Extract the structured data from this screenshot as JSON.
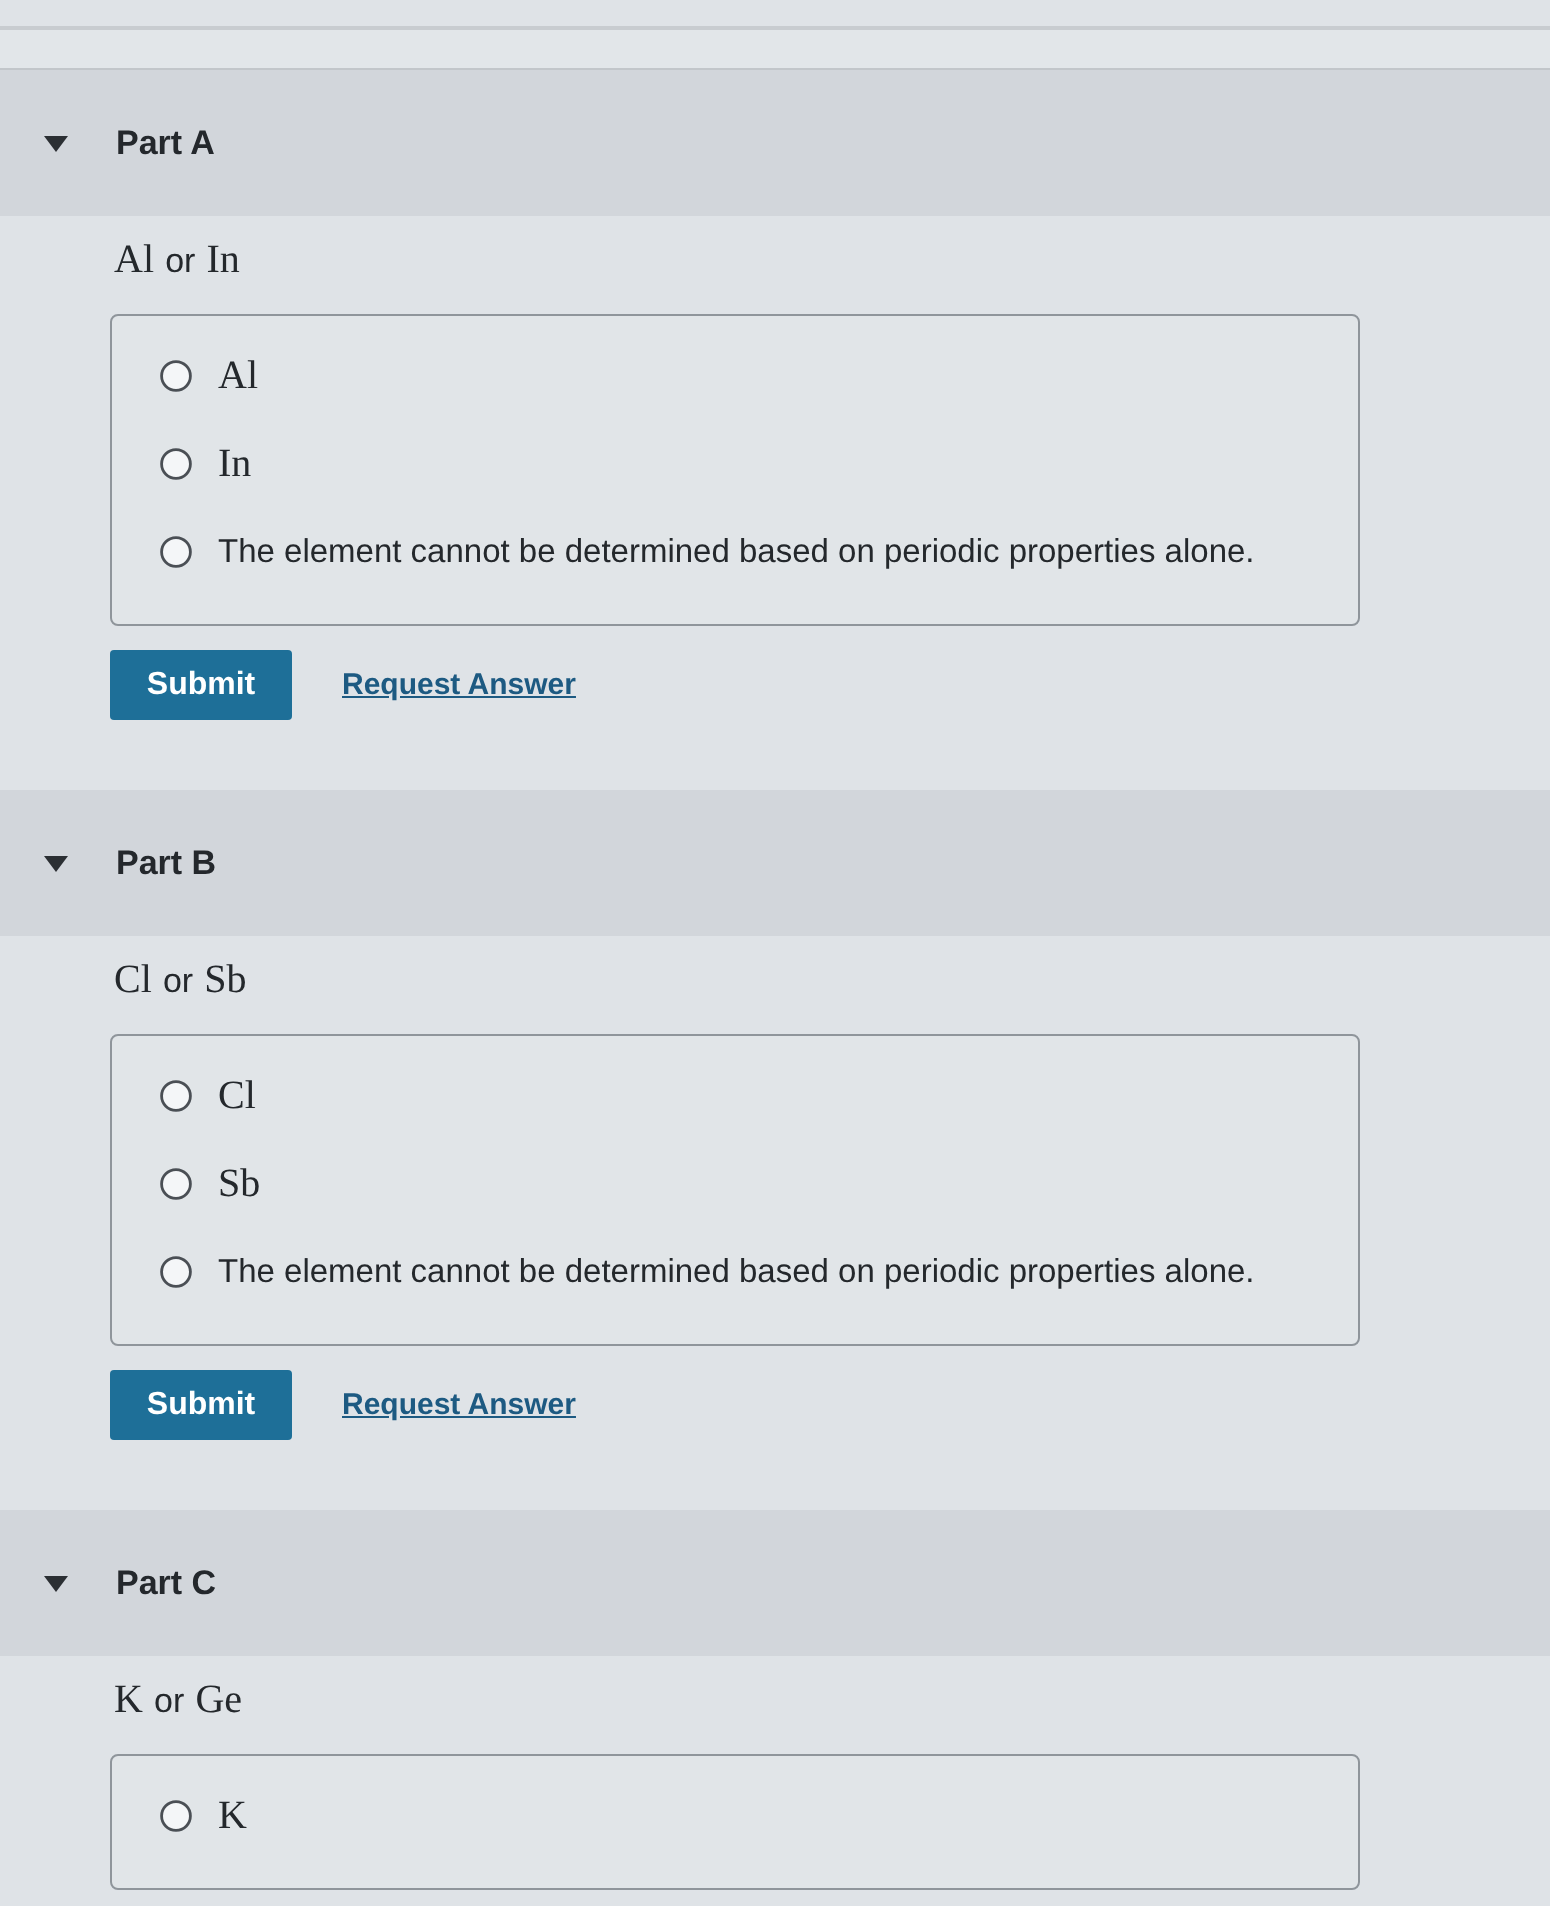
{
  "parts": [
    {
      "title": "Part A",
      "expanded": true,
      "prompt": [
        {
          "kind": "symbol",
          "text": "Al"
        },
        {
          "kind": "word",
          "text": "or"
        },
        {
          "kind": "symbol",
          "text": "In"
        }
      ],
      "options": [
        {
          "kind": "symbol",
          "text": "Al",
          "selected": false
        },
        {
          "kind": "symbol",
          "text": "In",
          "selected": false
        },
        {
          "kind": "sentence",
          "text": "The element cannot be determined based on periodic properties alone.",
          "selected": false
        }
      ],
      "submit": "Submit",
      "request_answer": "Request Answer"
    },
    {
      "title": "Part B",
      "expanded": true,
      "prompt": [
        {
          "kind": "symbol",
          "text": "Cl"
        },
        {
          "kind": "word",
          "text": "or"
        },
        {
          "kind": "symbol",
          "text": "Sb"
        }
      ],
      "options": [
        {
          "kind": "symbol",
          "text": "Cl",
          "selected": false
        },
        {
          "kind": "symbol",
          "text": "Sb",
          "selected": false
        },
        {
          "kind": "sentence",
          "text": "The element cannot be determined based on periodic properties alone.",
          "selected": false
        }
      ],
      "submit": "Submit",
      "request_answer": "Request Answer"
    },
    {
      "title": "Part C",
      "expanded": true,
      "prompt": [
        {
          "kind": "symbol",
          "text": "K"
        },
        {
          "kind": "word",
          "text": "or"
        },
        {
          "kind": "symbol",
          "text": "Ge"
        }
      ],
      "options": [
        {
          "kind": "symbol",
          "text": "K",
          "selected": false
        }
      ]
    }
  ]
}
